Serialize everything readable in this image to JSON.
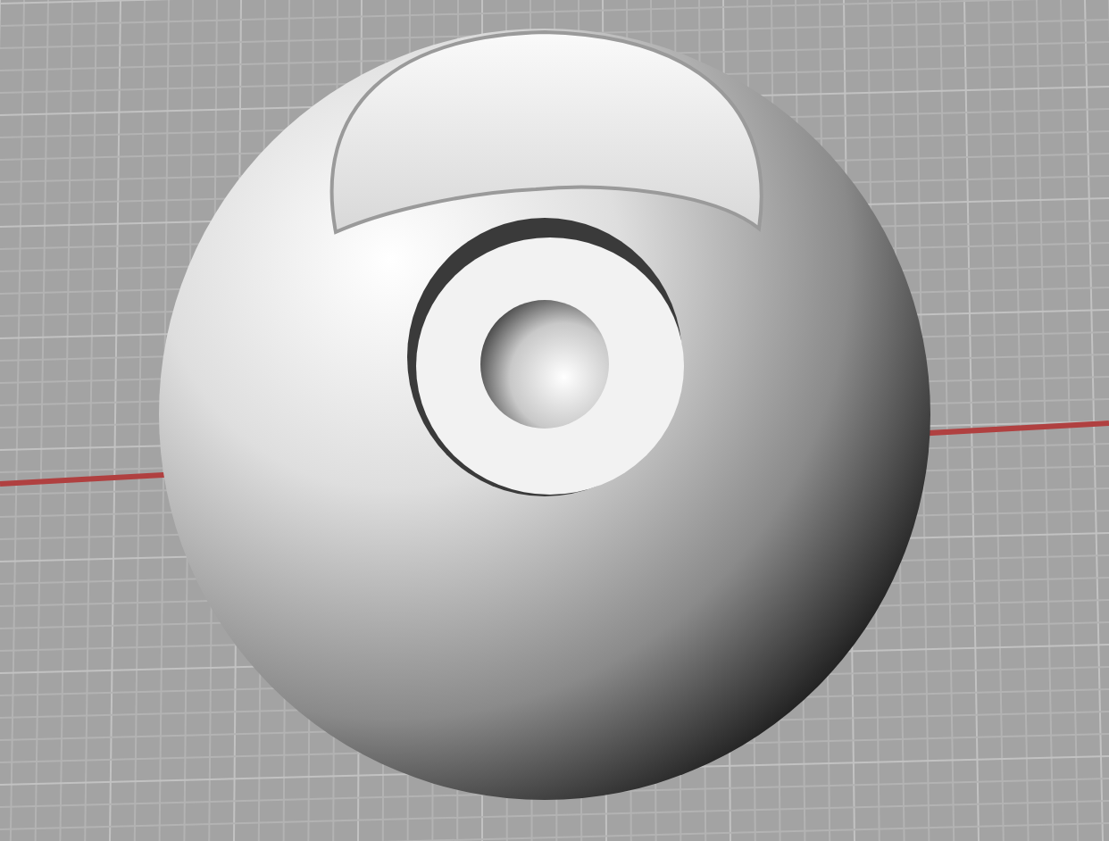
{
  "viewport": {
    "grid": true,
    "axis": true
  }
}
